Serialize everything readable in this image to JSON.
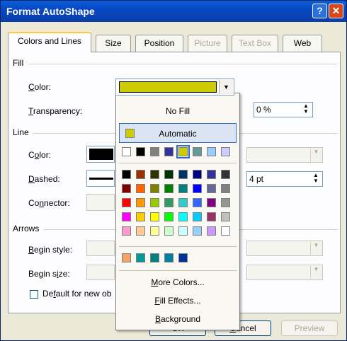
{
  "window": {
    "title": "Format AutoShape",
    "help_glyph": "?",
    "close_glyph": "✕"
  },
  "tabs": [
    {
      "label": "Colors and Lines",
      "active": true
    },
    {
      "label": "Size"
    },
    {
      "label": "Position"
    },
    {
      "label": "Picture",
      "disabled": true
    },
    {
      "label": "Text Box",
      "disabled": true
    },
    {
      "label": "Web"
    }
  ],
  "fill": {
    "section": "Fill",
    "color_label_pre": "",
    "color_label_u": "C",
    "color_label_post": "olor:",
    "transparency_label_u": "T",
    "transparency_label_post": "ransparency:",
    "transparency_value": "0 %",
    "selected_color": "#cccc00"
  },
  "line": {
    "section": "Line",
    "color_label_pre": "C",
    "color_label_u": "o",
    "color_label_post": "lor:",
    "dashed_label_u": "D",
    "dashed_label_post": "ashed:",
    "connector_label_pre": "Co",
    "connector_label_u": "n",
    "connector_label_post": "nector:",
    "weight_value": "4 pt"
  },
  "arrows": {
    "section": "Arrows",
    "begin_style_label_u": "B",
    "begin_style_label_post": "egin style:",
    "begin_size_label_pre": "Begin s",
    "begin_size_label_u": "i",
    "begin_size_label_post": "ze:"
  },
  "default_checkbox": {
    "pre": "De",
    "u": "f",
    "post": "ault for new ob"
  },
  "buttons": {
    "ok": "OK",
    "cancel_pre": "",
    "cancel_u": "C",
    "cancel_post": "ancel",
    "preview": "Preview"
  },
  "popup": {
    "no_fill": "No Fill",
    "automatic": "Automatic",
    "automatic_color": "#cccc00",
    "recent_colors": [
      "#ffffff",
      "#000000",
      "#808080",
      "#333399",
      "#cccc00",
      "#669999",
      "#99ccff",
      "#ccccff"
    ],
    "palette": [
      [
        "#000000",
        "#993300",
        "#333300",
        "#003300",
        "#003366",
        "#000080",
        "#333399",
        "#333333"
      ],
      [
        "#800000",
        "#ff6600",
        "#808000",
        "#008000",
        "#008080",
        "#0000ff",
        "#666699",
        "#808080"
      ],
      [
        "#ff0000",
        "#ff9900",
        "#99cc00",
        "#339966",
        "#33cccc",
        "#3366ff",
        "#800080",
        "#969696"
      ],
      [
        "#ff00ff",
        "#ffcc00",
        "#ffff00",
        "#00ff00",
        "#00ffff",
        "#00ccff",
        "#993366",
        "#c0c0c0"
      ],
      [
        "#ff99cc",
        "#ffcc99",
        "#ffff99",
        "#ccffcc",
        "#ccffff",
        "#99ccff",
        "#cc99ff",
        "#ffffff"
      ]
    ],
    "extra_colors": [
      "#f4a460",
      "#009999",
      "#008080",
      "#0080a0",
      "#003399"
    ],
    "more_colors_pre": "",
    "more_colors_u": "M",
    "more_colors_post": "ore Colors...",
    "fill_effects_pre": "",
    "fill_effects_u": "F",
    "fill_effects_post": "ill Effects...",
    "background_pre": "",
    "background_u": "B",
    "background_post": "ackground"
  }
}
